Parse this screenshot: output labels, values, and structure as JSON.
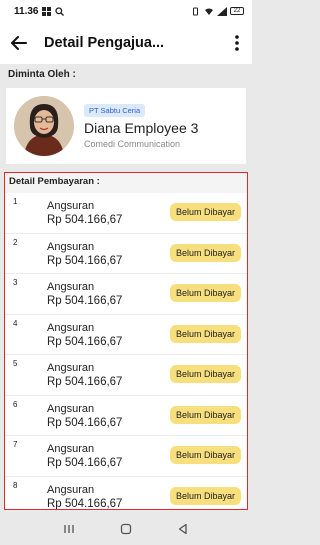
{
  "status_bar": {
    "time": "11.36",
    "battery": "22"
  },
  "app_bar": {
    "title": "Detail Pengajua..."
  },
  "requester": {
    "label": "Diminta Oleh :",
    "company": "PT Sabtu Ceria",
    "name": "Diana Employee 3",
    "department": "Comedi Communication"
  },
  "payment": {
    "label": "Detail Pembayaran :",
    "rows": [
      {
        "num": "1",
        "title": "Angsuran",
        "amount": "Rp 504.166,67",
        "status": "Belum Dibayar"
      },
      {
        "num": "2",
        "title": "Angsuran",
        "amount": "Rp 504.166,67",
        "status": "Belum Dibayar"
      },
      {
        "num": "3",
        "title": "Angsuran",
        "amount": "Rp 504.166,67",
        "status": "Belum Dibayar"
      },
      {
        "num": "4",
        "title": "Angsuran",
        "amount": "Rp 504.166,67",
        "status": "Belum Dibayar"
      },
      {
        "num": "5",
        "title": "Angsuran",
        "amount": "Rp 504.166,67",
        "status": "Belum Dibayar"
      },
      {
        "num": "6",
        "title": "Angsuran",
        "amount": "Rp 504.166,67",
        "status": "Belum Dibayar"
      },
      {
        "num": "7",
        "title": "Angsuran",
        "amount": "Rp 504.166,67",
        "status": "Belum Dibayar"
      },
      {
        "num": "8",
        "title": "Angsuran",
        "amount": "Rp 504.166,67",
        "status": "Belum Dibayar"
      }
    ]
  },
  "colors": {
    "accent_red": "#e02a2a",
    "badge_yellow": "#f7df7e",
    "chip_blue": "#dce9fb",
    "chip_text": "#2c63c8"
  },
  "icons": {
    "back": "arrow-left-icon",
    "menu": "more-vertical-icon"
  }
}
